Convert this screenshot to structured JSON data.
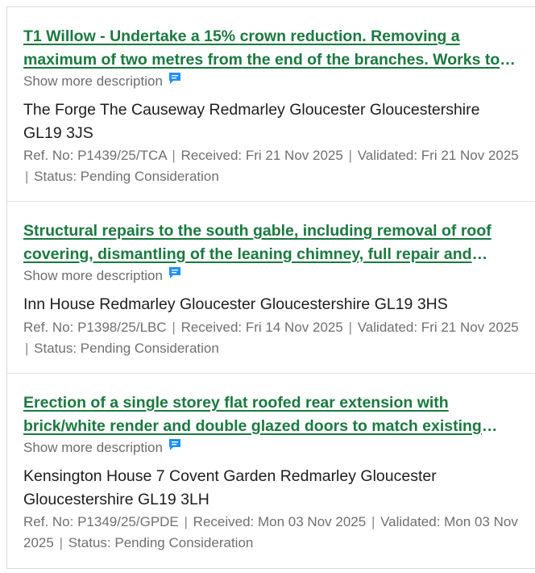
{
  "applications": [
    {
      "title": "T1 Willow - Undertake a 15% crown reduction. Removing a maximum of two metres from the end of the branches. Works to improve the health of the tree.",
      "show_more": "Show more description",
      "address": "The Forge The Causeway Redmarley Gloucester Gloucestershire GL19 3JS",
      "ref": "Ref. No: P1439/25/TCA",
      "received": "Received: Fri 21 Nov 2025",
      "validated": "Validated: Fri 21 Nov 2025",
      "status": "Status: Pending Consideration"
    },
    {
      "title": "Structural repairs to the south gable, including removal of roof covering, dismantling of the leaning chimney, full repair and rebuild.",
      "show_more": "Show more description",
      "address": "Inn House Redmarley Gloucester Gloucestershire GL19 3HS",
      "ref": "Ref. No: P1398/25/LBC",
      "received": "Received: Fri 14 Nov 2025",
      "validated": "Validated: Fri 21 Nov 2025",
      "status": "Status: Pending Consideration"
    },
    {
      "title": "Erection of a single storey flat roofed rear extension with brick/white render and double glazed doors to match existing dwelling.",
      "show_more": "Show more description",
      "address": "Kensington House 7 Covent Garden Redmarley Gloucester Gloucestershire GL19 3LH",
      "ref": "Ref. No: P1349/25/GPDE",
      "received": "Received: Mon 03 Nov 2025",
      "validated": "Validated: Mon 03 Nov 2025",
      "status": "Status: Pending Consideration"
    }
  ],
  "separator": "|",
  "colors": {
    "link": "#1a7a3f",
    "icon": "#1e90ff",
    "muted": "#707070"
  },
  "icons": {
    "comment": "comment-icon"
  }
}
